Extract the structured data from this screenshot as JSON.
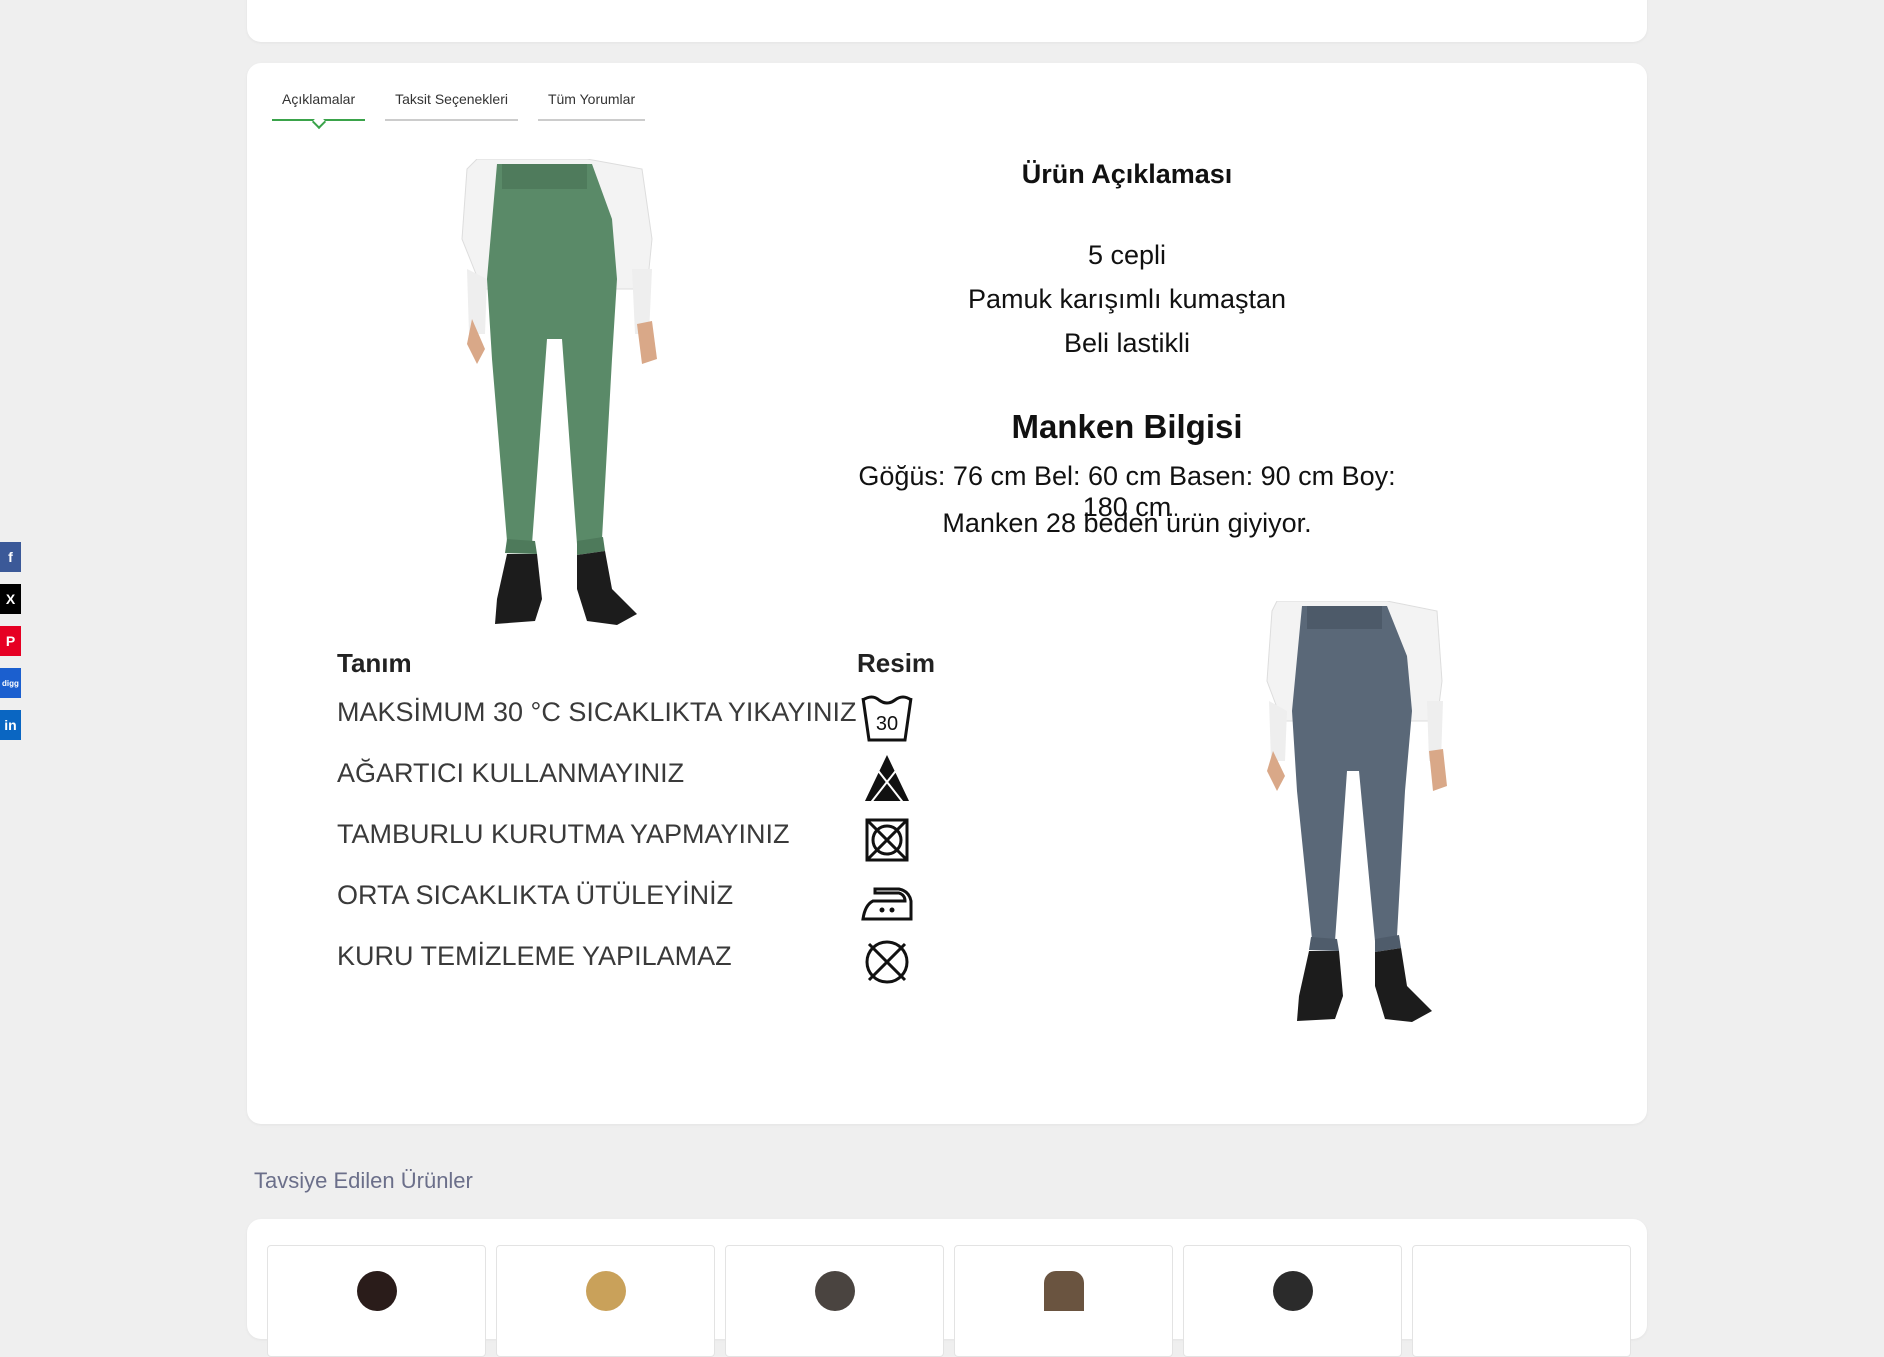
{
  "tabs": [
    "Açıklamalar",
    "Taksit Seçenekleri",
    "Tüm Yorumlar"
  ],
  "description": {
    "title": "Ürün Açıklaması",
    "lines": [
      "5 cepli",
      "Pamuk karışımlı kumaştan",
      "Beli lastikli"
    ]
  },
  "manken": {
    "title": "Manken Bilgisi",
    "measurements": "Göğüs: 76 cm Bel: 60 cm Basen: 90 cm Boy: 180 cm",
    "size": "Manken 28 beden ürün giyiyor."
  },
  "care": {
    "header_label": "Tanım",
    "header_icon": "Resim",
    "rows": [
      {
        "text": "MAKSİMUM 30 °C SICAKLIKTA YIKAYINIZ",
        "icon": "wash-30-icon",
        "icon_text": "30"
      },
      {
        "text": "AĞARTICI KULLANMAYINIZ",
        "icon": "no-bleach-icon"
      },
      {
        "text": "TAMBURLU KURUTMA YAPMAYINIZ",
        "icon": "no-tumble-dry-icon"
      },
      {
        "text": "ORTA SICAKLIKTA ÜTÜLEYİNİZ",
        "icon": "iron-medium-icon"
      },
      {
        "text": "KURU TEMİZLEME YAPILAMAZ",
        "icon": "no-dry-clean-icon"
      }
    ]
  },
  "social": [
    {
      "name": "facebook",
      "label": "f",
      "color": "#3b5998"
    },
    {
      "name": "x",
      "label": "X",
      "color": "#000000"
    },
    {
      "name": "pinterest",
      "label": "P",
      "color": "#e60023"
    },
    {
      "name": "digg",
      "label": "digg",
      "color": "#1b5fcf"
    },
    {
      "name": "linkedin",
      "label": "in",
      "color": "#0a66c2"
    }
  ],
  "recommended": {
    "title": "Tavsiye Edilen Ürünler"
  },
  "colors": {
    "accent": "#3aa34a",
    "green_jeans": "#5a8a68",
    "grey_jeans": "#5a6878"
  }
}
